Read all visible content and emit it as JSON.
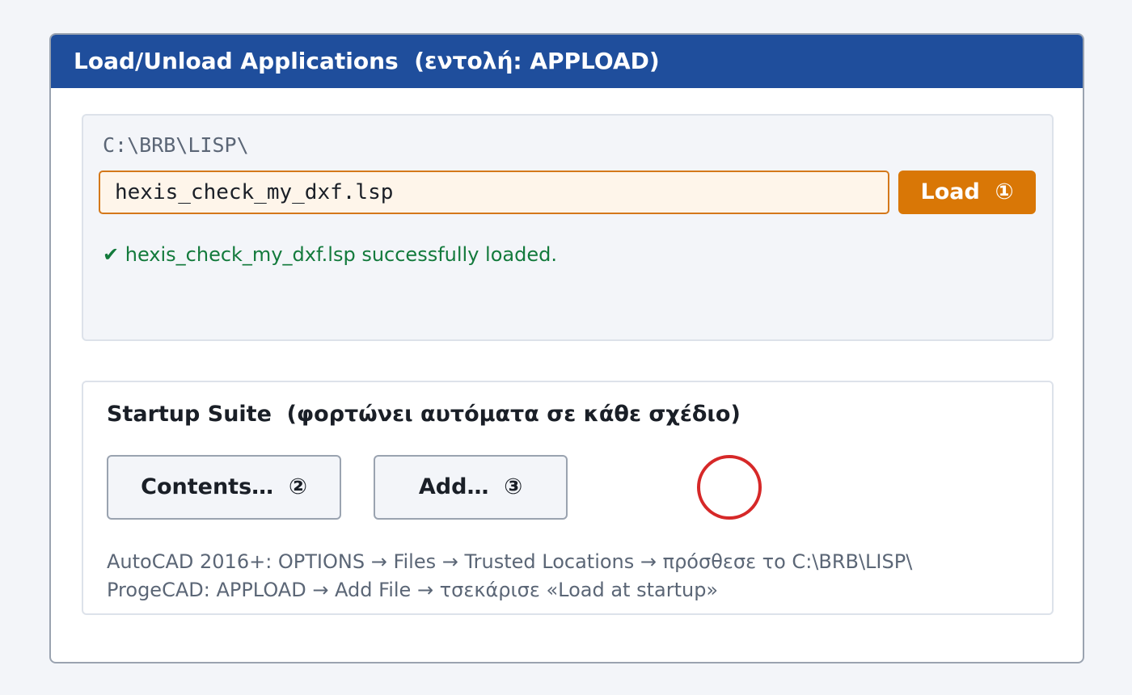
{
  "dialog": {
    "title": "Load/Unload Applications  (εντολή: APPLOAD)"
  },
  "load_panel": {
    "path": "C:\\BRB\\LISP\\",
    "file_name": "hexis_check_my_dxf.lsp",
    "load_button": "Load  ①",
    "status": "✔ hexis_check_my_dxf.lsp successfully loaded."
  },
  "startup_suite": {
    "title": "Startup Suite  (φορτώνει αυτόματα σε κάθε σχέδιο)",
    "contents_button": "Contents…  ②",
    "add_button": "Add…  ③",
    "notes": [
      "AutoCAD 2016+: OPTIONS → Files → Trusted Locations → πρόσθεσε το C:\\BRB\\LISP\\",
      "ProgeCAD: APPLOAD → Add File → τσεκάρισε «Load at startup»"
    ]
  },
  "colors": {
    "titlebar": "#1f4e9c",
    "accent": "#d97706",
    "success": "#137a3c",
    "cursor_ring": "#d62828"
  }
}
